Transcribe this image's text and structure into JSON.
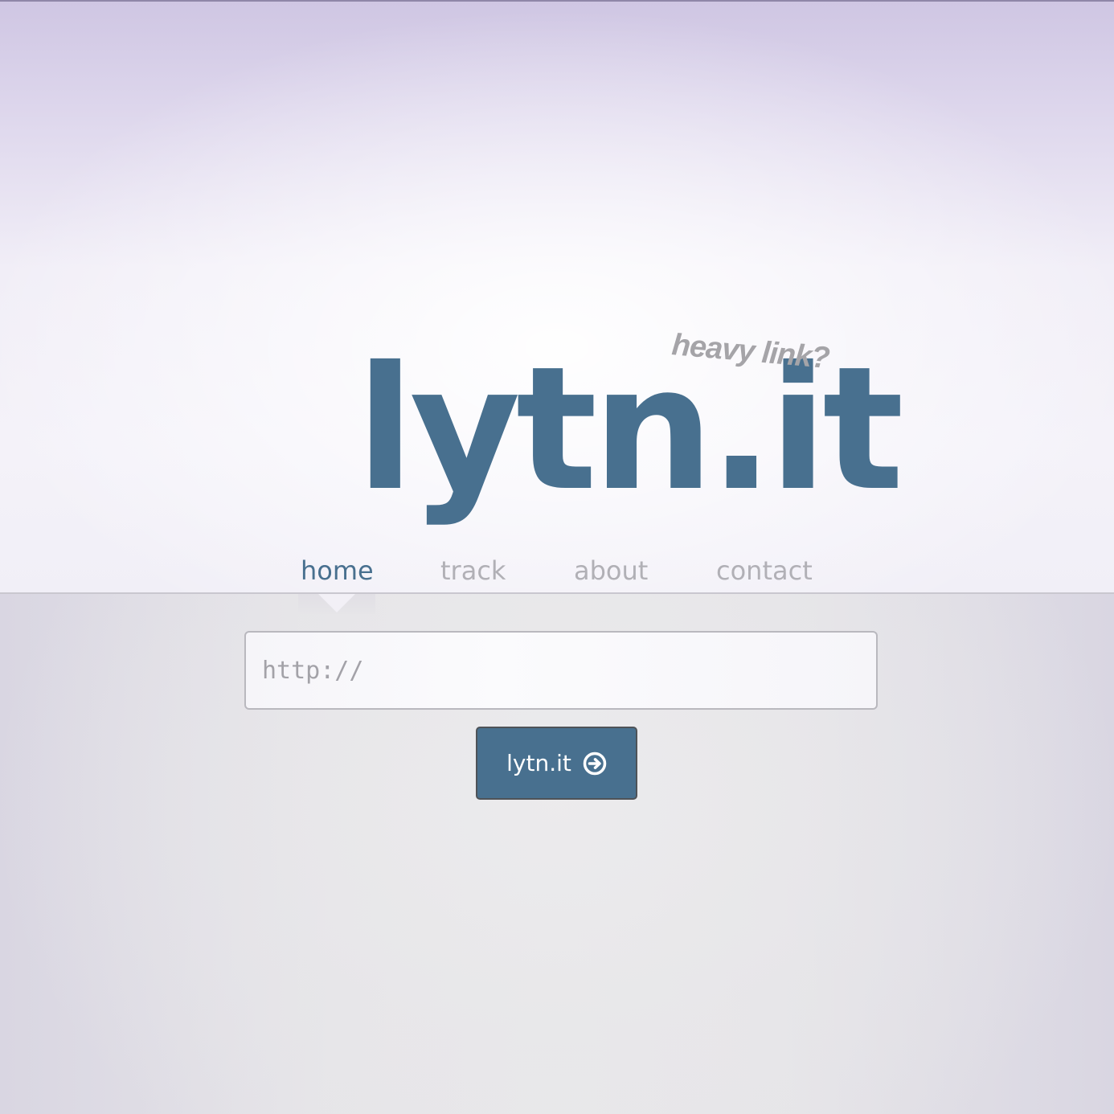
{
  "brand": {
    "logo_text": "lytn.it",
    "tagline": "heavy link?",
    "primary_color": "#48708f"
  },
  "nav": {
    "items": [
      {
        "label": "home",
        "active": true
      },
      {
        "label": "track",
        "active": false
      },
      {
        "label": "about",
        "active": false
      },
      {
        "label": "contact",
        "active": false
      }
    ]
  },
  "form": {
    "url_placeholder": "http://",
    "url_value": "",
    "submit_label": "lytn.it",
    "submit_icon": "arrow-right-circle-icon"
  }
}
